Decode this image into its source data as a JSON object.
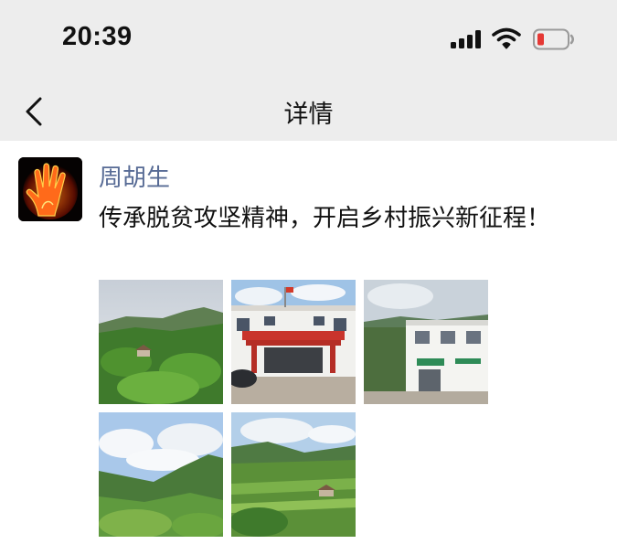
{
  "status": {
    "time": "20:39"
  },
  "nav": {
    "title": "详情"
  },
  "post": {
    "author": "周胡生",
    "text": "传承脱贫攻坚精神，开启乡村振兴新征程！",
    "images": [
      {
        "name": "mountain-village-photo"
      },
      {
        "name": "village-office-building-photo"
      },
      {
        "name": "white-building-photo"
      },
      {
        "name": "cloudy-mountains-photo"
      },
      {
        "name": "hillside-fields-photo"
      }
    ]
  },
  "colors": {
    "header_bg": "#ededed",
    "author_link": "#576b95",
    "battery_low": "#e53935"
  },
  "icons": {
    "back": "chevron-left-icon",
    "signal": "signal-bars-icon",
    "wifi": "wifi-icon",
    "battery": "battery-low-icon"
  }
}
